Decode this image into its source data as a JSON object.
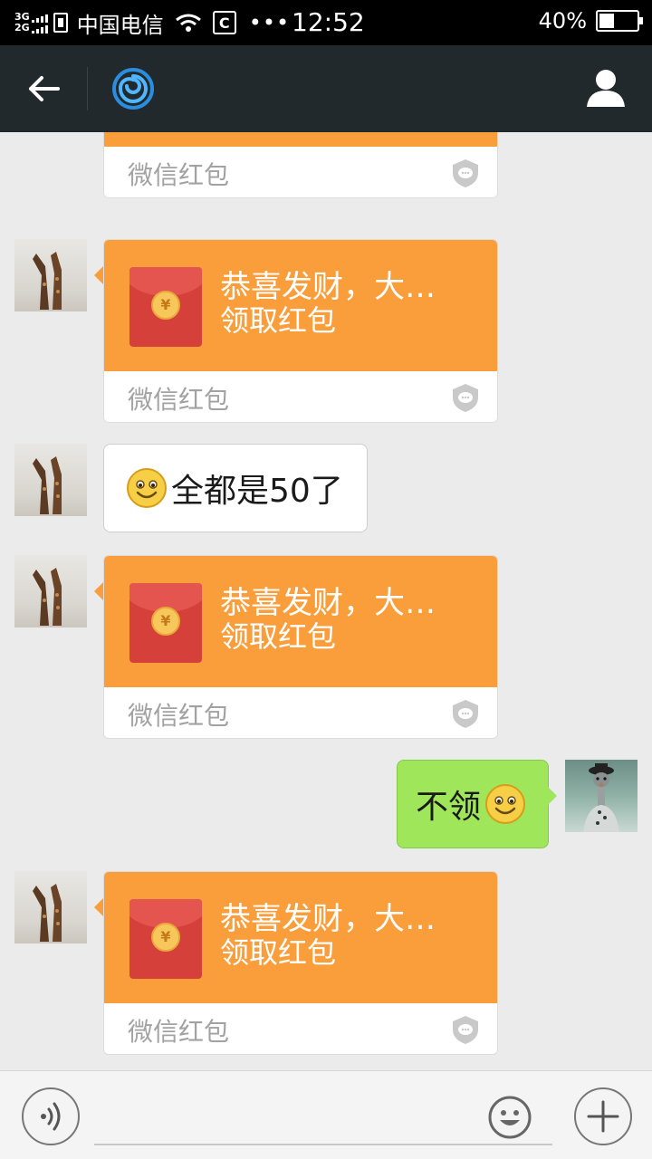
{
  "status_bar": {
    "network_top": "3G",
    "network_bottom": "2G",
    "carrier": "中国电信",
    "more": "•••",
    "time": "12:52",
    "battery_percent": "40%",
    "battery_level": 0.4
  },
  "title_bar": {
    "back_icon": "back-arrow-icon",
    "chat_icon": "spiral-logo-icon",
    "profile_icon": "person-icon"
  },
  "messages": [
    {
      "type": "red_packet",
      "sender": "other",
      "label": "微信红包"
    },
    {
      "type": "red_packet",
      "sender": "other",
      "title": "恭喜发财，大…",
      "subtitle": "领取红包",
      "label": "微信红包"
    },
    {
      "type": "text",
      "sender": "other",
      "emoji": "smile-emoji",
      "text": "全都是50了"
    },
    {
      "type": "red_packet",
      "sender": "other",
      "title": "恭喜发财，大…",
      "subtitle": "领取红包",
      "label": "微信红包"
    },
    {
      "type": "text",
      "sender": "me",
      "text": "不领",
      "emoji": "smile-emoji"
    },
    {
      "type": "red_packet",
      "sender": "other",
      "title": "恭喜发财，大…",
      "subtitle": "领取红包",
      "label": "微信红包"
    }
  ],
  "coin_symbol": "¥",
  "input_bar": {
    "voice_icon": "voice-icon",
    "emoji_icon": "emoji-icon",
    "plus_icon": "plus-icon",
    "input_value": ""
  },
  "colors": {
    "red_packet": "#fa9e3b",
    "outgoing_bubble": "#9fe65a",
    "title_bar": "#22292c"
  }
}
